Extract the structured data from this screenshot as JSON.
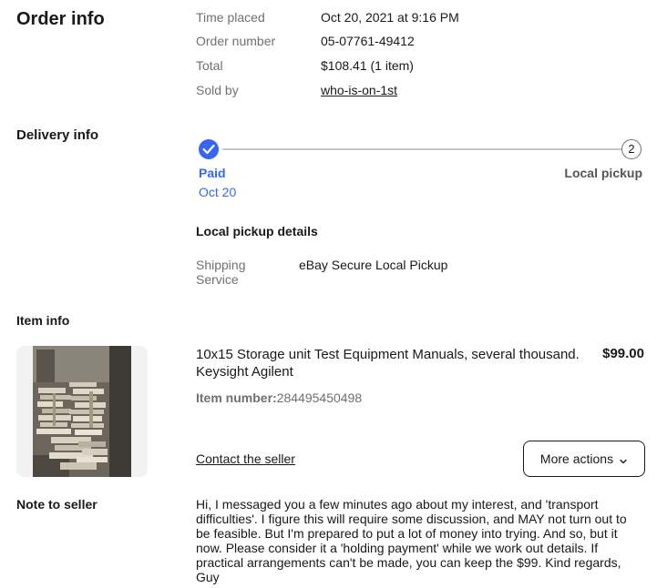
{
  "order_info": {
    "heading": "Order info",
    "time_placed_label": "Time placed",
    "time_placed_value": "Oct 20, 2021 at 9:16 PM",
    "order_number_label": "Order number",
    "order_number_value": "05-07761-49412",
    "total_label": "Total",
    "total_value": "$108.41 (1 item)",
    "sold_by_label": "Sold by",
    "sold_by_value": "who-is-on-1st"
  },
  "delivery_info": {
    "heading": "Delivery info",
    "step1_label": "Paid",
    "step1_date": "Oct 20",
    "step2_number": "2",
    "step2_label": "Local pickup",
    "progress": 0.5,
    "pickup_details_heading": "Local pickup details",
    "shipping_service_label_1": "Shipping",
    "shipping_service_label_2": "Service",
    "shipping_service_value": "eBay Secure Local Pickup"
  },
  "item_info": {
    "heading": "Item info",
    "title_line1": "10x15 Storage unit Test Equipment Manuals, several thousand.",
    "title_line2": "Keysight Agilent",
    "price": "$99.00",
    "item_number_label": "Item number:",
    "item_number_value": "284495450498",
    "contact_seller": "Contact the seller",
    "more_actions": "More actions",
    "image_subject": "storage-unit-manuals-photo"
  },
  "note_to_seller": {
    "heading": "Note to seller",
    "lines": [
      "Hi, I messaged you a few minutes ago about my interest, and 'transport",
      "difficulties'. I figure this will require some discussion, and MAY not turn out to",
      "be feasible. But I'm prepared to put a lot of money into trying. And so, but it",
      "now. Please consider it a 'holding payment' while we work out details. If",
      "practical arrangements can't be made, you can keep the $99. Kind regards,",
      "Guy"
    ]
  },
  "colors": {
    "accent": "#3665f3",
    "text": "#191919",
    "muted": "#707070"
  }
}
